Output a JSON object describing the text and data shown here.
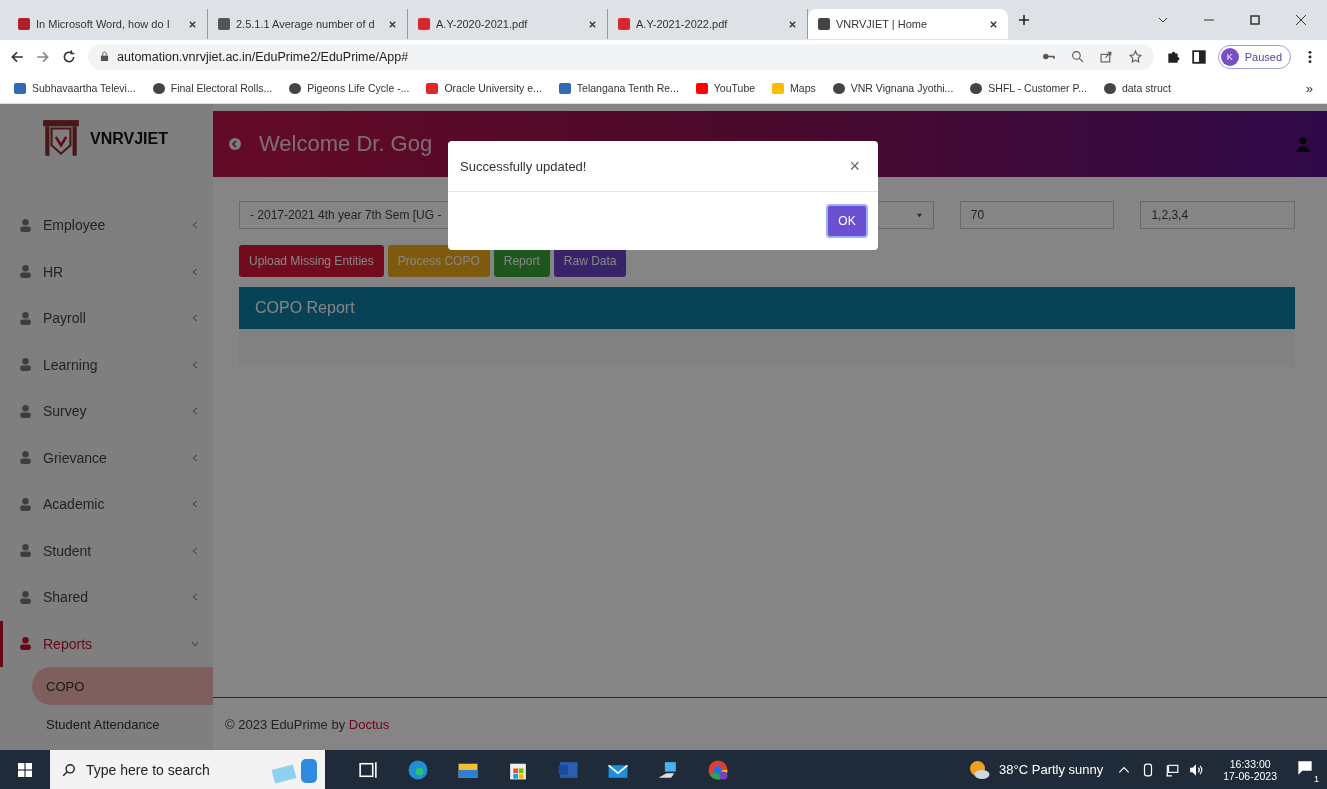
{
  "browser": {
    "tabs": [
      {
        "title": "In Microsoft Word, how do I",
        "selected": false
      },
      {
        "title": "2.5.1.1 Average number of d",
        "selected": false
      },
      {
        "title": "A.Y-2020-2021.pdf",
        "selected": false
      },
      {
        "title": "A.Y-2021-2022.pdf",
        "selected": false
      },
      {
        "title": "VNRVJIET | Home",
        "selected": true
      }
    ],
    "url": "automation.vnrvjiet.ac.in/EduPrime2/EduPrime/App#",
    "profile_initial": "K",
    "profile_status": "Paused",
    "bookmarks": [
      "Subhavaartha Televi...",
      "Final Electoral Rolls...",
      "Pigeons Life Cycle -...",
      "Oracle University e...",
      "Telangana Tenth Re...",
      "YouTube",
      "Maps",
      "VNR Vignana Jyothi...",
      "SHFL - Customer P...",
      "data struct"
    ],
    "more": "»"
  },
  "app": {
    "brand": "VNRVJIET",
    "welcome": "Welcome Dr. Gog",
    "sidebar": [
      {
        "label": "Employee",
        "expanded": false,
        "selected": false
      },
      {
        "label": "HR",
        "expanded": false,
        "selected": false
      },
      {
        "label": "Payroll",
        "expanded": false,
        "selected": false
      },
      {
        "label": "Learning",
        "expanded": false,
        "selected": false
      },
      {
        "label": "Survey",
        "expanded": false,
        "selected": false
      },
      {
        "label": "Grievance",
        "expanded": false,
        "selected": false
      },
      {
        "label": "Academic",
        "expanded": false,
        "selected": false
      },
      {
        "label": "Student",
        "expanded": false,
        "selected": false
      },
      {
        "label": "Shared",
        "expanded": false,
        "selected": false
      },
      {
        "label": "Reports",
        "expanded": true,
        "selected": true,
        "children": [
          {
            "label": "COPO",
            "selected": true
          },
          {
            "label": "Student Attendance",
            "selected": false
          }
        ]
      }
    ],
    "select_value": "- 2017-2021 4th year 7th Sem [UG -",
    "fields": [
      "70",
      "1,2,3,4"
    ],
    "buttons": [
      "Upload Missing Entities",
      "Process COPO",
      "Report",
      "Raw Data"
    ],
    "panel_title": "COPO Report",
    "footer": {
      "text": "© 2023 EduPrime by ",
      "link": "Doctus"
    }
  },
  "dialog": {
    "message": "Successfully updated!",
    "close": "×",
    "ok": "OK"
  },
  "taskbar": {
    "search_placeholder": "Type here to search",
    "weather": "38°C  Partly sunny",
    "time": "16:33:00",
    "date": "17-06-2023",
    "notifications": "1"
  }
}
